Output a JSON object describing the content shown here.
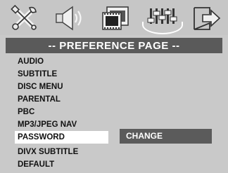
{
  "toolbar": {
    "icons": [
      {
        "name": "tools-icon"
      },
      {
        "name": "speaker-icon"
      },
      {
        "name": "film-icon"
      },
      {
        "name": "preference-icon",
        "selected": true
      },
      {
        "name": "exit-icon"
      }
    ]
  },
  "title": "-- PREFERENCE PAGE --",
  "menu": {
    "items": [
      {
        "label": "AUDIO"
      },
      {
        "label": "SUBTITLE"
      },
      {
        "label": "DISC MENU"
      },
      {
        "label": "PARENTAL"
      },
      {
        "label": "PBC"
      },
      {
        "label": "MP3/JPEG NAV"
      },
      {
        "label": "PASSWORD",
        "active": true
      },
      {
        "label": "DIVX SUBTITLE"
      },
      {
        "label": "DEFAULT"
      }
    ]
  },
  "submenu": {
    "label": "CHANGE"
  },
  "colors": {
    "background": "#c9c9c9",
    "banner": "#5a5a5a",
    "highlight": "#ffffff",
    "text_dark": "#111111",
    "text_light": "#ffffff"
  }
}
